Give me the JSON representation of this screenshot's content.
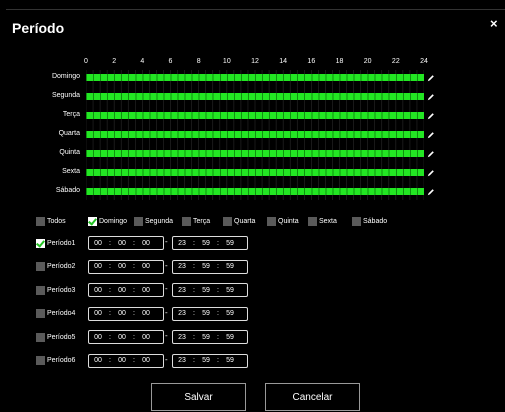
{
  "dialog": {
    "title": "Período",
    "close_symbol": "×"
  },
  "hours": [
    "0",
    "2",
    "4",
    "6",
    "8",
    "10",
    "12",
    "14",
    "16",
    "18",
    "20",
    "22",
    "24"
  ],
  "days": [
    {
      "label": "Domingo"
    },
    {
      "label": "Segunda"
    },
    {
      "label": "Terça"
    },
    {
      "label": "Quarta"
    },
    {
      "label": "Quinta"
    },
    {
      "label": "Sexta"
    },
    {
      "label": "Sábado"
    }
  ],
  "day_checks": [
    {
      "label": "Todos",
      "checked": false
    },
    {
      "label": "Domingo",
      "checked": true
    },
    {
      "label": "Segunda",
      "checked": false
    },
    {
      "label": "Terça",
      "checked": false
    },
    {
      "label": "Quarta",
      "checked": false
    },
    {
      "label": "Quinta",
      "checked": false
    },
    {
      "label": "Sexta",
      "checked": false
    },
    {
      "label": "Sábado",
      "checked": false
    }
  ],
  "periods": [
    {
      "label": "Período1",
      "checked": true,
      "start": [
        "00",
        "00",
        "00"
      ],
      "end": [
        "23",
        "59",
        "59"
      ]
    },
    {
      "label": "Período2",
      "checked": false,
      "start": [
        "00",
        "00",
        "00"
      ],
      "end": [
        "23",
        "59",
        "59"
      ]
    },
    {
      "label": "Período3",
      "checked": false,
      "start": [
        "00",
        "00",
        "00"
      ],
      "end": [
        "23",
        "59",
        "59"
      ]
    },
    {
      "label": "Período4",
      "checked": false,
      "start": [
        "00",
        "00",
        "00"
      ],
      "end": [
        "23",
        "59",
        "59"
      ]
    },
    {
      "label": "Período5",
      "checked": false,
      "start": [
        "00",
        "00",
        "00"
      ],
      "end": [
        "23",
        "59",
        "59"
      ]
    },
    {
      "label": "Período6",
      "checked": false,
      "start": [
        "00",
        "00",
        "00"
      ],
      "end": [
        "23",
        "59",
        "59"
      ]
    }
  ],
  "time_separator": ":",
  "range_separator": "-",
  "buttons": {
    "save": "Salvar",
    "cancel": "Cancelar"
  },
  "colors": {
    "bar": "#23e623",
    "check": "#22c322",
    "unchecked_box": "#5a5a5a"
  },
  "icons": {
    "edit": "pencil-icon",
    "close": "close-icon",
    "check": "checkmark-icon"
  }
}
